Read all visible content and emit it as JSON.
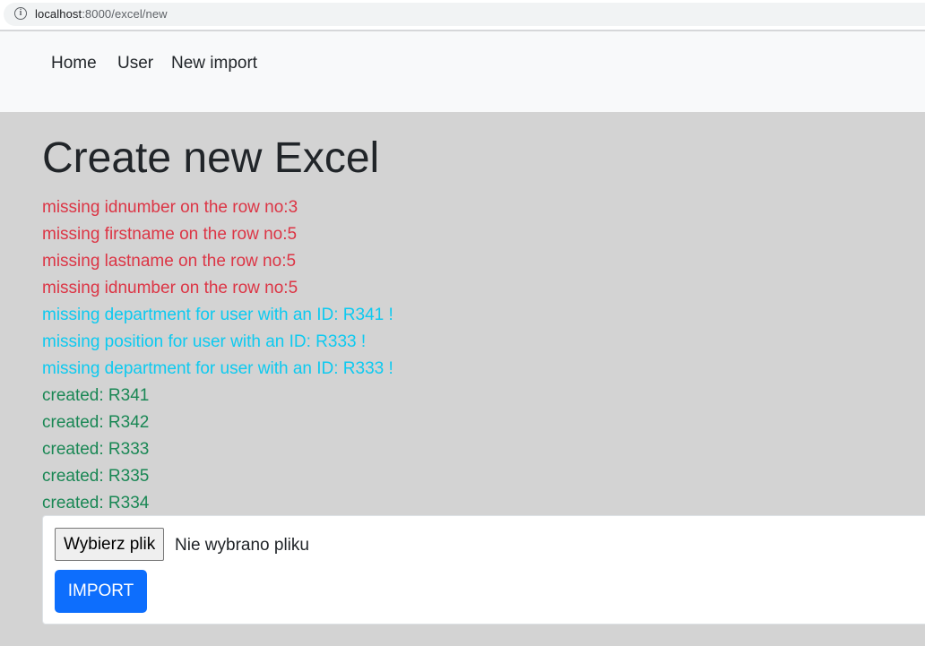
{
  "browser": {
    "url_host": "localhost",
    "url_path": ":8000/excel/new"
  },
  "nav": {
    "items": [
      {
        "label": "Home"
      },
      {
        "label": "User"
      },
      {
        "label": "New import"
      }
    ]
  },
  "page": {
    "title": "Create new Excel"
  },
  "messages": {
    "errors": [
      "missing idnumber on the row no:3",
      "missing firstname on the row no:5",
      "missing lastname on the row no:5",
      "missing idnumber on the row no:5"
    ],
    "warnings": [
      "missing department for user with an ID: R341 !",
      "missing position for user with an ID: R333 !",
      "missing department for user with an ID: R333 !"
    ],
    "created": [
      "created: R341",
      "created: R342",
      "created: R333",
      "created: R335",
      "created: R334"
    ]
  },
  "form": {
    "file_button_label": "Wybierz plik",
    "file_status": "Nie wybrano pliku",
    "import_label": "IMPORT"
  },
  "colors": {
    "error": "#dc3545",
    "warning": "#0dcaf0",
    "success": "#198754",
    "primary": "#0d6efd",
    "background": "#d3d3d3"
  }
}
